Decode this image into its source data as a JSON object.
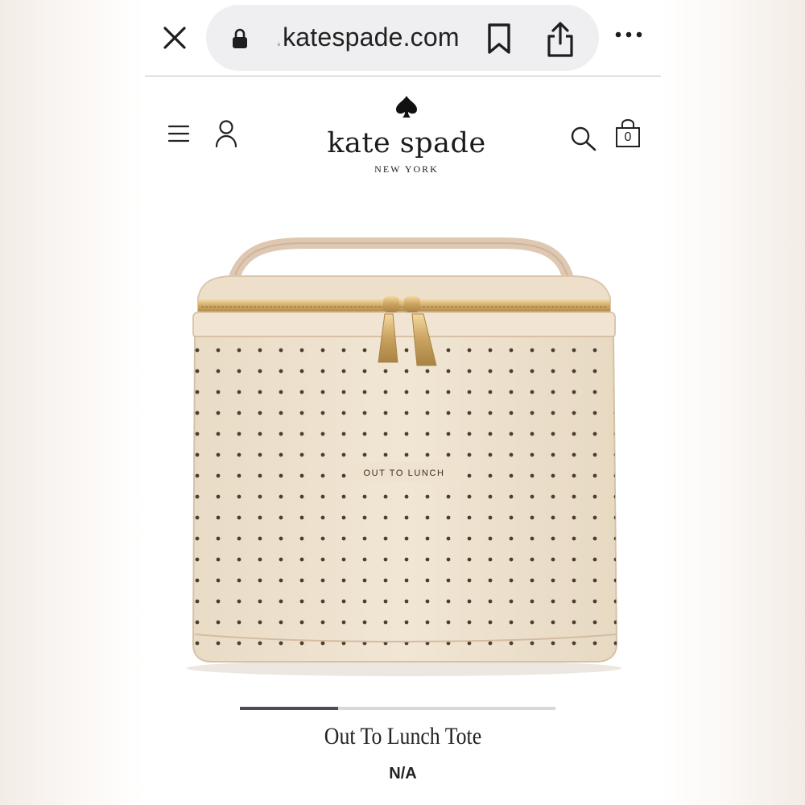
{
  "browser": {
    "url_faded": ".",
    "url_main": "katespade.com"
  },
  "site": {
    "brand": "kate spade",
    "brand_sub": "NEW YORK",
    "bag_count": "0"
  },
  "product": {
    "print_text": "OUT TO LUNCH",
    "title": "Out To Lunch Tote",
    "price": "N/A",
    "carousel_progress": 0.31
  },
  "colors": {
    "canvas": "#efe3cf",
    "dot": "#3a2b22",
    "zipper": "#c9a25e"
  },
  "icons": [
    "close-icon",
    "lock-icon",
    "bookmark-icon",
    "share-icon",
    "more-icon",
    "menu-icon",
    "account-icon",
    "spade-icon",
    "search-icon",
    "bag-icon"
  ]
}
